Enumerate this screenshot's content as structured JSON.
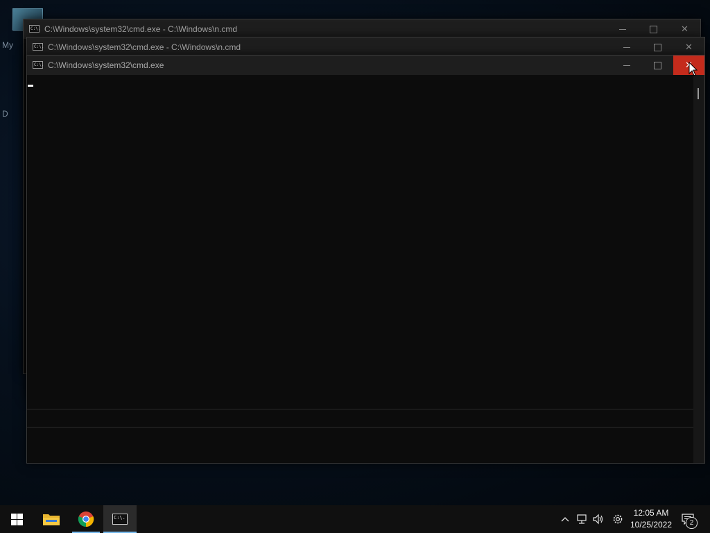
{
  "desktop": {
    "labels": [
      {
        "text": "My",
        "top": 0
      },
      {
        "text": "D",
        "top": 0
      }
    ]
  },
  "windows": [
    {
      "title": "C:\\Windows\\system32\\cmd.exe - C:\\Windows\\n.cmd",
      "icon_text": "C:\\."
    },
    {
      "title": "C:\\Windows\\system32\\cmd.exe - C:\\Windows\\n.cmd",
      "icon_text": "C:\\."
    },
    {
      "title": "C:\\Windows\\system32\\cmd.exe",
      "icon_text": "C:\\."
    }
  ],
  "window_controls": {
    "minimize_glyph": "",
    "close_glyph": "✕"
  },
  "taskbar": {
    "clock_time": "12:05 AM",
    "clock_date": "10/25/2022",
    "notification_count": "2",
    "cmd_icon_text": "C:\\."
  },
  "colors": {
    "close_hover": "#c42b1c",
    "taskbar_accent": "#76b9ed",
    "console_bg": "#0c0c0c"
  }
}
